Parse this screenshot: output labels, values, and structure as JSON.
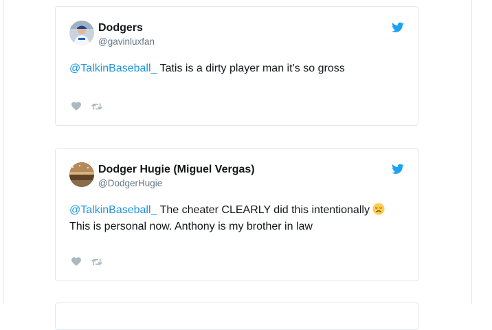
{
  "tweets": [
    {
      "display_name": "Dodgers",
      "username": "@gavinluxfan",
      "mention": "@TalkinBaseball_",
      "text": " Tatis is a dirty player man it’s so gross",
      "avatar_icon": "dodgers-player-avatar"
    },
    {
      "display_name": "Dodger Hugie (Miguel Vergas)",
      "username": "@DodgerHugie",
      "mention": "@TalkinBaseball_",
      "text": " The cheater CLEARLY did this intentionally ",
      "emoji": "disappointed-face-emoji",
      "text_line2": "This is personal now. Anthony is my brother in law",
      "avatar_icon": "stadium-avatar"
    }
  ],
  "colors": {
    "twitter_blue": "#1da1f2",
    "mention_blue": "#1b95e0",
    "action_gray": "#aab8c2",
    "border": "#e1e8ed"
  },
  "icons": {
    "brand": "twitter-bird-icon",
    "like": "heart-icon",
    "retweet": "retweet-icon"
  }
}
